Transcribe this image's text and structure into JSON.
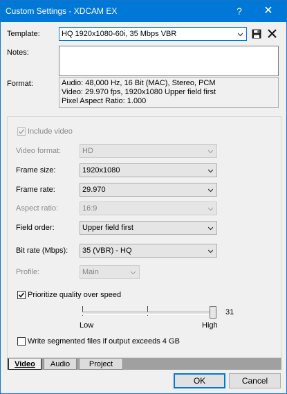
{
  "window": {
    "title": "Custom Settings - XDCAM EX",
    "help_glyph": "?",
    "close_glyph": "✕"
  },
  "template": {
    "label": "Template:",
    "value": "HQ 1920x1080-60i, 35 Mbps VBR"
  },
  "notes": {
    "label": "Notes:",
    "value": ""
  },
  "format": {
    "label": "Format:",
    "lines": [
      "Audio: 48,000 Hz, 16 Bit (MAC), Stereo, PCM",
      "Video: 29.970 fps, 1920x1080 Upper field first",
      "Pixel Aspect Ratio: 1.000"
    ]
  },
  "video": {
    "include_video": {
      "label": "Include video",
      "checked": true,
      "enabled": false
    },
    "video_format": {
      "label": "Video format:",
      "value": "HD",
      "enabled": false
    },
    "frame_size": {
      "label": "Frame size:",
      "value": "1920x1080"
    },
    "frame_rate": {
      "label": "Frame rate:",
      "value": "29.970"
    },
    "aspect_ratio": {
      "label": "Aspect ratio:",
      "value": "16:9",
      "enabled": false
    },
    "field_order": {
      "label": "Field order:",
      "value": "Upper field first"
    },
    "bit_rate": {
      "label": "Bit rate (Mbps):",
      "value": "35 (VBR) - HQ"
    },
    "profile": {
      "label": "Profile:",
      "value": "Main",
      "enabled": false
    },
    "prioritize_quality": {
      "label": "Prioritize quality over speed",
      "checked": true
    },
    "quality_slider": {
      "value": "31",
      "level": 1.0,
      "low_label": "Low",
      "high_label": "High"
    },
    "write_segmented": {
      "label": "Write segmented files if output exceeds 4 GB",
      "checked": false
    }
  },
  "tabs": [
    {
      "label": "Video",
      "active": true
    },
    {
      "label": "Audio",
      "active": false
    },
    {
      "label": "Project",
      "active": false
    }
  ],
  "buttons": {
    "ok": "OK",
    "cancel": "Cancel"
  },
  "colors": {
    "titlebar": "#0078d7",
    "focus_border": "#0078d7"
  }
}
